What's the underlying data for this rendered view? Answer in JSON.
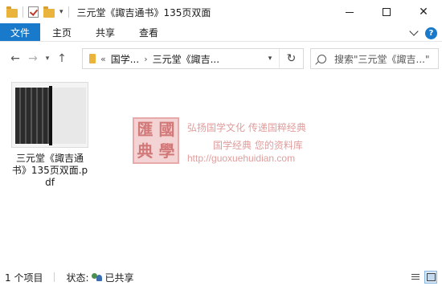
{
  "window": {
    "title": "三元堂《諏吉通书》135页双面"
  },
  "ribbon": {
    "tabs": [
      "文件",
      "主页",
      "共享",
      "查看"
    ]
  },
  "address": {
    "overflow": "«",
    "crumbs": [
      "国学...",
      "三元堂《諏吉..."
    ]
  },
  "search": {
    "placeholder": "搜索\"三元堂《諏吉...\""
  },
  "file": {
    "name": "三元堂《諏吉通书》135页双面.pdf"
  },
  "watermark": {
    "seal": [
      "匯",
      "國",
      "典",
      "學"
    ],
    "line1": "弘扬国学文化  传递国粹经典",
    "line2": "国学经典 您的资料库",
    "url": "http://guoxuehuidian.com"
  },
  "status": {
    "count": "1 个项目",
    "state_label": "状态:",
    "state_value": "已共享"
  }
}
